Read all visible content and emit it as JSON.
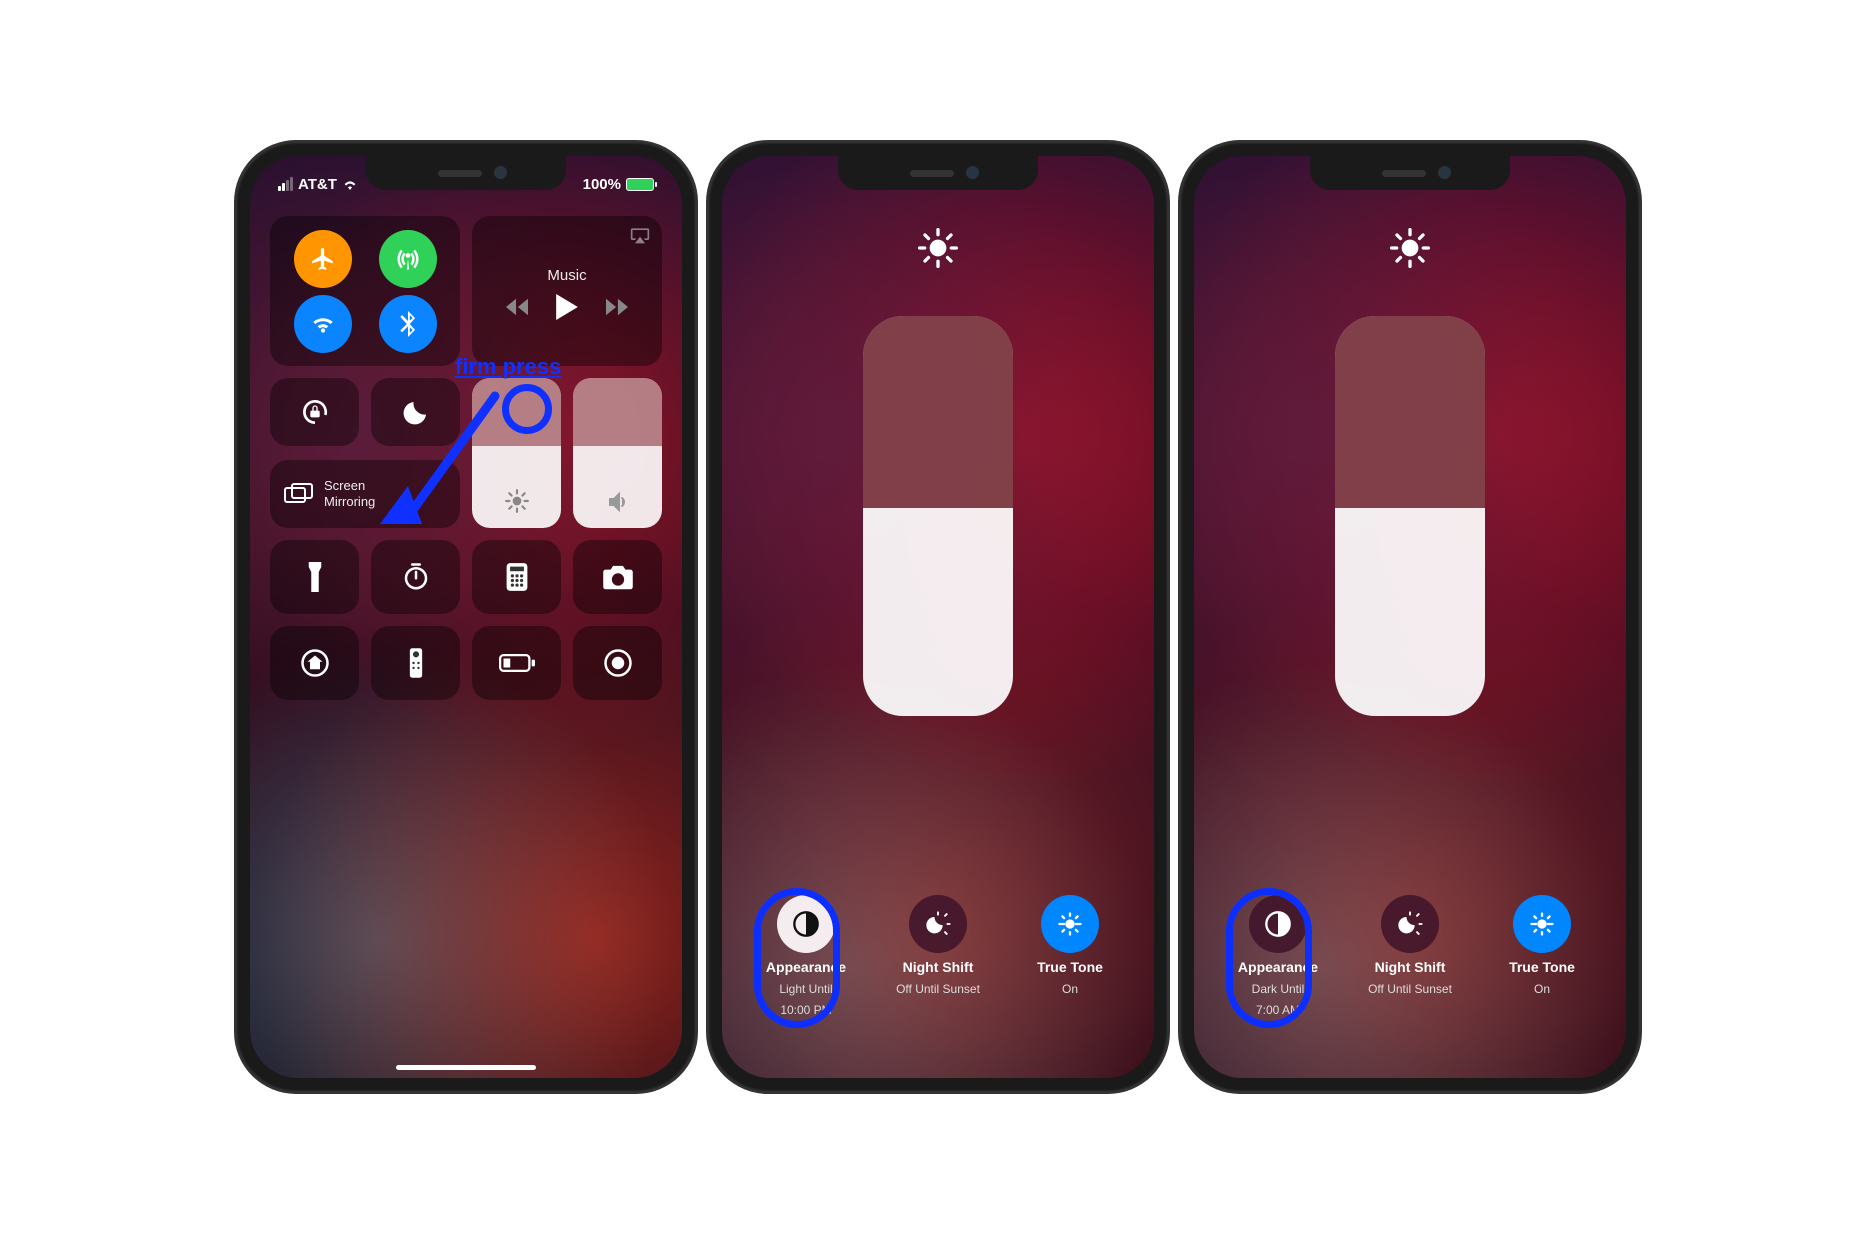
{
  "annotation": {
    "label": "firm press"
  },
  "phone1": {
    "status": {
      "carrier": "AT&T",
      "battery_pct": "100%"
    },
    "media": {
      "label": "Music"
    },
    "mirror": {
      "label": "Screen Mirroring"
    },
    "brightness_pct": 55,
    "volume_pct": 55,
    "shortcut_icons": [
      "flashlight",
      "timer",
      "calculator",
      "camera",
      "home",
      "remote",
      "low-power",
      "screen-record"
    ]
  },
  "phone2": {
    "brightness_pct": 52,
    "buttons": [
      {
        "title": "Appearance",
        "sub1": "Light Until",
        "sub2": "10:00 PM",
        "icon": "appearance",
        "style": "light"
      },
      {
        "title": "Night Shift",
        "sub1": "Off Until Sunset",
        "sub2": "",
        "icon": "night-shift",
        "style": "dark"
      },
      {
        "title": "True Tone",
        "sub1": "On",
        "sub2": "",
        "icon": "true-tone",
        "style": "blue"
      }
    ]
  },
  "phone3": {
    "brightness_pct": 52,
    "buttons": [
      {
        "title": "Appearance",
        "sub1": "Dark Until",
        "sub2": "7:00 AM",
        "icon": "appearance",
        "style": "dark"
      },
      {
        "title": "Night Shift",
        "sub1": "Off Until Sunset",
        "sub2": "",
        "icon": "night-shift",
        "style": "dark"
      },
      {
        "title": "True Tone",
        "sub1": "On",
        "sub2": "",
        "icon": "true-tone",
        "style": "blue"
      }
    ]
  }
}
